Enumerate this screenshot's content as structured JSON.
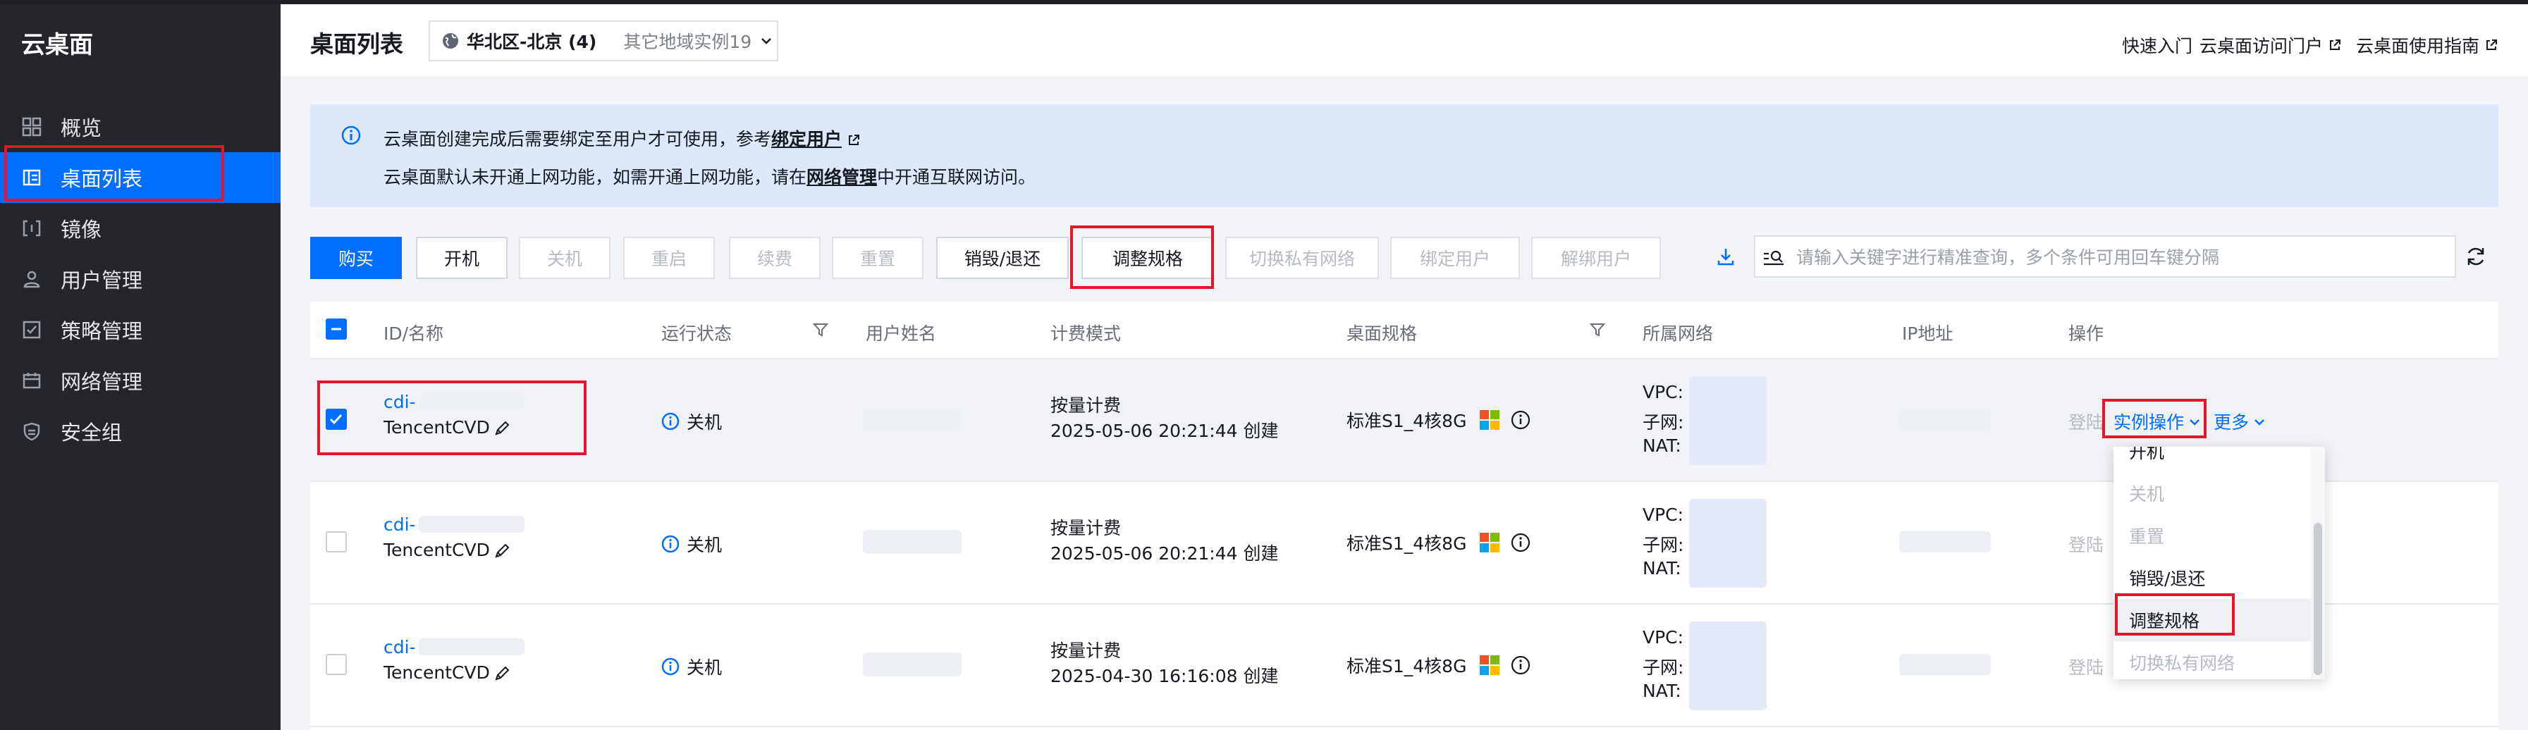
{
  "sidebar": {
    "title": "云桌面",
    "items": [
      {
        "label": "概览",
        "icon": "grid-icon"
      },
      {
        "label": "桌面列表",
        "icon": "desktop-list-icon"
      },
      {
        "label": "镜像",
        "icon": "image-icon"
      },
      {
        "label": "用户管理",
        "icon": "user-icon"
      },
      {
        "label": "策略管理",
        "icon": "policy-icon"
      },
      {
        "label": "网络管理",
        "icon": "network-icon"
      },
      {
        "label": "安全组",
        "icon": "shield-icon"
      }
    ]
  },
  "header": {
    "title": "桌面列表",
    "region": "华北区-北京 (4)",
    "other_regions": "其它地域实例19",
    "links": [
      "快速入门",
      "云桌面访问门户",
      "云桌面使用指南"
    ]
  },
  "notice": {
    "line1_pre": "云桌面创建完成后需要绑定至用户才可使用，参考",
    "line1_link": "绑定用户",
    "line2_pre": "云桌面默认未开通上网功能，如需开通上网功能，请在",
    "line2_link": "网络管理",
    "line2_post": "中开通互联网访问。"
  },
  "toolbar": {
    "buttons": [
      "购买",
      "开机",
      "关机",
      "重启",
      "续费",
      "重置",
      "销毁/退还",
      "调整规格",
      "切换私有网络",
      "绑定用户",
      "解绑用户"
    ],
    "search_placeholder": "请输入关键字进行精准查询，多个条件可用回车键分隔"
  },
  "table": {
    "headers": [
      "ID/名称",
      "运行状态",
      "用户姓名",
      "计费模式",
      "桌面规格",
      "所属网络",
      "IP地址",
      "操作"
    ],
    "rows": [
      {
        "id": "cdi-",
        "name": "TencentCVD",
        "status": "关机",
        "billing": "按量计费",
        "created": "2025-05-06 20:21:44 创建",
        "spec": "标准S1_4核8G",
        "vpc": "VPC:",
        "subnet": "子网:",
        "nat": "NAT:",
        "login": "登陆",
        "instance_op": "实例操作",
        "more": "更多",
        "selected": true
      },
      {
        "id": "cdi-",
        "name": "TencentCVD",
        "status": "关机",
        "billing": "按量计费",
        "created": "2025-05-06 20:21:44 创建",
        "spec": "标准S1_4核8G",
        "vpc": "VPC:",
        "subnet": "子网:",
        "nat": "NAT:",
        "login": "登陆",
        "selected": false
      },
      {
        "id": "cdi-",
        "name": "TencentCVD",
        "status": "关机",
        "billing": "按量计费",
        "created": "2025-04-30 16:16:08 创建",
        "spec": "标准S1_4核8G",
        "vpc": "VPC:",
        "subnet": "子网:",
        "nat": "NAT:",
        "login": "登陆",
        "selected": false
      }
    ]
  },
  "dropdown": {
    "items": [
      "开机",
      "关机",
      "重置",
      "销毁/退还",
      "调整规格",
      "切换私有网络"
    ]
  },
  "colors": {
    "accent": "#006eff",
    "highlight": "#e5152d",
    "sidebar": "#24262b"
  }
}
